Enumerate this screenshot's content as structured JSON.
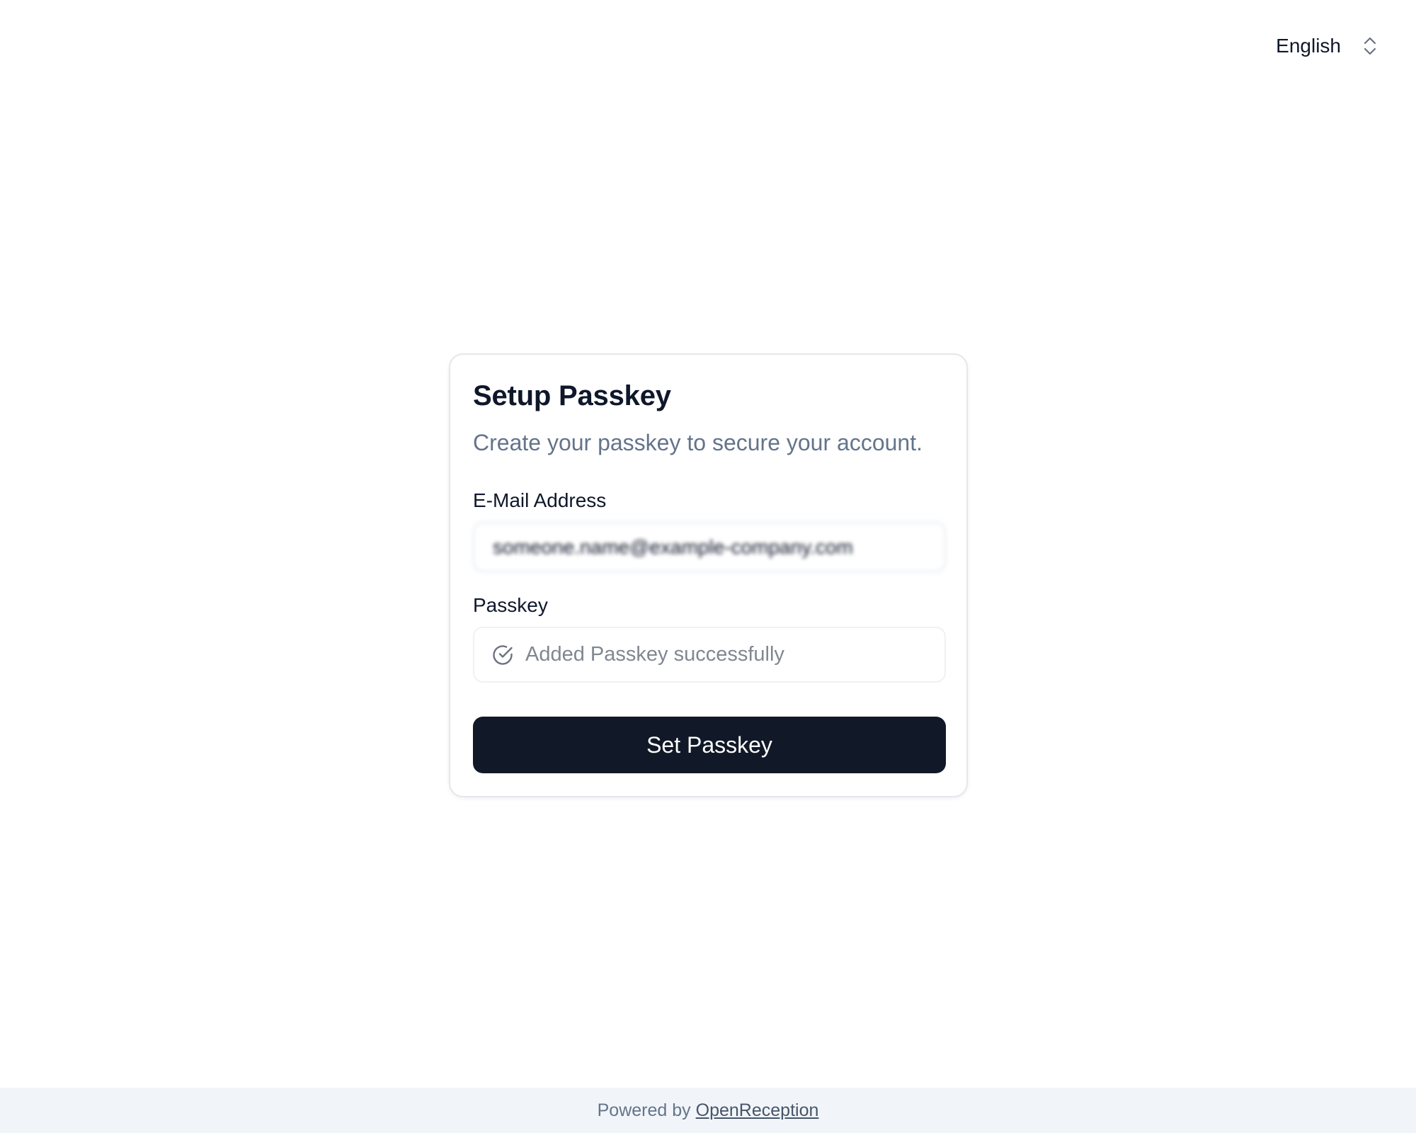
{
  "language_selector": {
    "selected": "English",
    "icon": "chevron-up-down-icon"
  },
  "card": {
    "title": "Setup Passkey",
    "subtitle": "Create your passkey to secure your account.",
    "email": {
      "label": "E-Mail Address",
      "value": "someone.name@example-company.com"
    },
    "passkey": {
      "label": "Passkey",
      "status": "Added Passkey successfully",
      "icon": "check-circle-icon"
    },
    "submit_label": "Set Passkey"
  },
  "footer": {
    "prefix": "Powered by",
    "link_text": "OpenReception"
  },
  "colors": {
    "primary_button": "#111827",
    "muted_text": "#64748b",
    "footer_bg": "#f1f5f9"
  }
}
